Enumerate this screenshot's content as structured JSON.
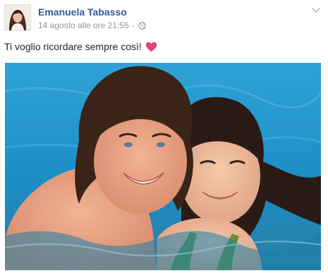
{
  "post": {
    "author": "Emanuela Tabasso",
    "timestamp": "14 agosto alle ore 21:55",
    "separator": "·",
    "audience_icon": "globe-icon",
    "options_icon": "chevron-down-icon",
    "message": "Ti voglio ricordare sempre così!",
    "message_emoji": "heart-icon",
    "colors": {
      "author_link": "#385898",
      "meta_text": "#90949c",
      "heart": "#e0436f",
      "pool_water": "#1e93c9"
    }
  }
}
